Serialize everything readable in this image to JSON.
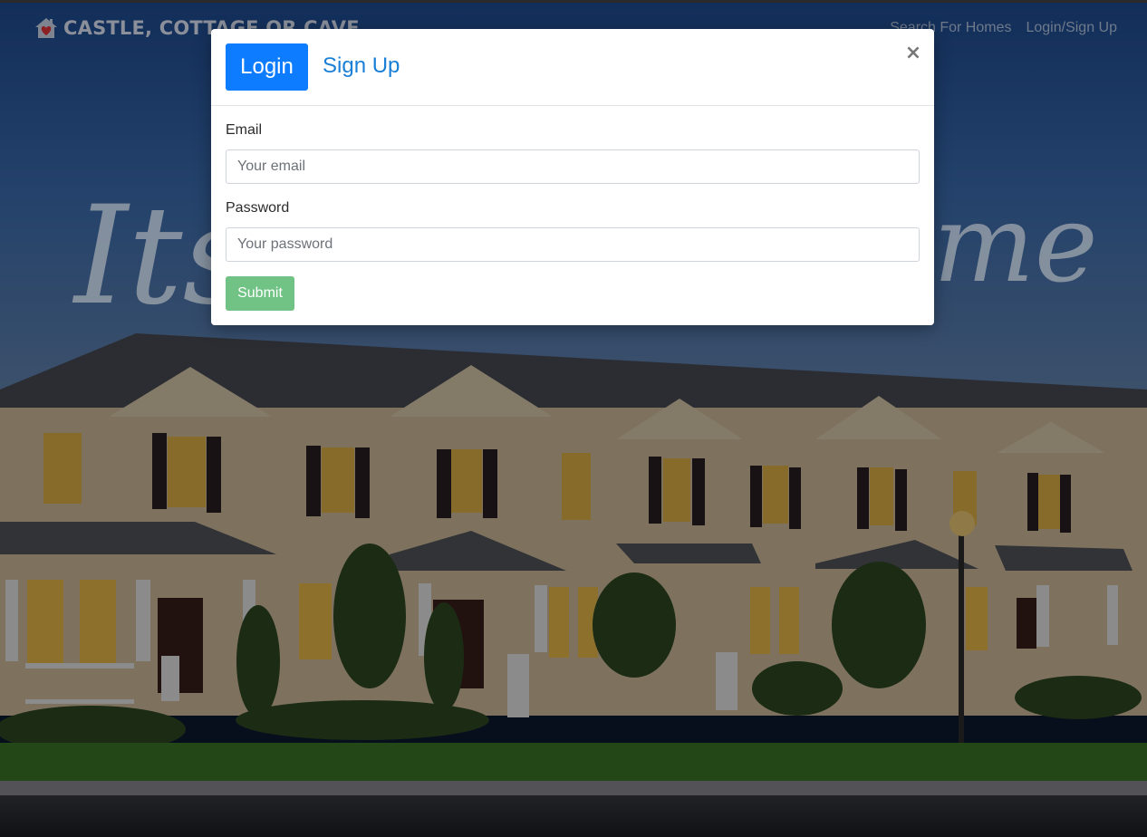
{
  "navbar": {
    "brand": "CASTLE, COTTAGE OR CAVE",
    "brand_icon": "house-heart-icon",
    "links": [
      "Search For Homes",
      "Login/Sign Up"
    ]
  },
  "hero": {
    "left_text": "Its",
    "right_text": "me"
  },
  "modal": {
    "tab_login": "Login",
    "tab_signup": "Sign Up",
    "close": "×",
    "email_label": "Email",
    "email_placeholder": "Your email",
    "password_label": "Password",
    "password_placeholder": "Your password",
    "submit": "Submit"
  },
  "colors": {
    "primary": "#0d7cff",
    "link": "#1a7fd6",
    "submit": "#71c285"
  }
}
